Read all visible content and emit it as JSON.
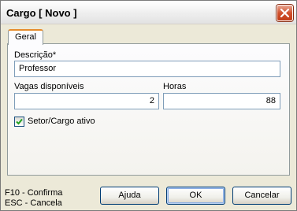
{
  "window": {
    "title": "Cargo [ Novo ]"
  },
  "tabs": [
    {
      "label": "Geral",
      "active": true
    }
  ],
  "form": {
    "descricao_label": "Descrição*",
    "descricao_value": "Professor",
    "vagas_label": "Vagas disponíveis",
    "vagas_value": "2",
    "horas_label": "Horas",
    "horas_value": "88",
    "setor_ativo_label": "Setor/Cargo ativo",
    "setor_ativo_checked": true
  },
  "footer": {
    "hint_confirm": "F10 - Confirma",
    "hint_cancel": "ESC - Cancela",
    "help_label": "Ajuda",
    "ok_label": "OK",
    "cancel_label": "Cancelar"
  },
  "colors": {
    "tab_accent": "#e68b2c",
    "close_button": "#d0512e",
    "field_border": "#7f9db9"
  }
}
